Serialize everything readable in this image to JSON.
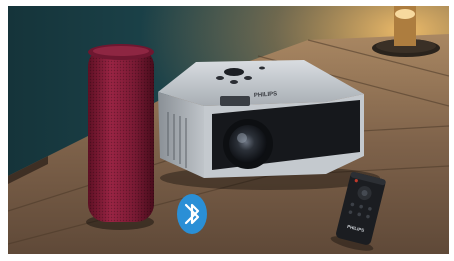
{
  "scene": {
    "colors": {
      "wall": "#1f4a52",
      "table": "#8a6a4c",
      "speaker": "#8e1f3a",
      "projector_body": "#b7bcc2",
      "projector_front": "#1a1c20",
      "bluetooth_badge": "#2a8fd6",
      "lamp_glow": "#f2b25a",
      "remote": "#1b1d21"
    },
    "projector": {
      "brand_label": "PHILIPS"
    },
    "remote": {
      "brand_label": "PHILIPS"
    },
    "bluetooth": {
      "icon": "bluetooth-icon"
    }
  }
}
